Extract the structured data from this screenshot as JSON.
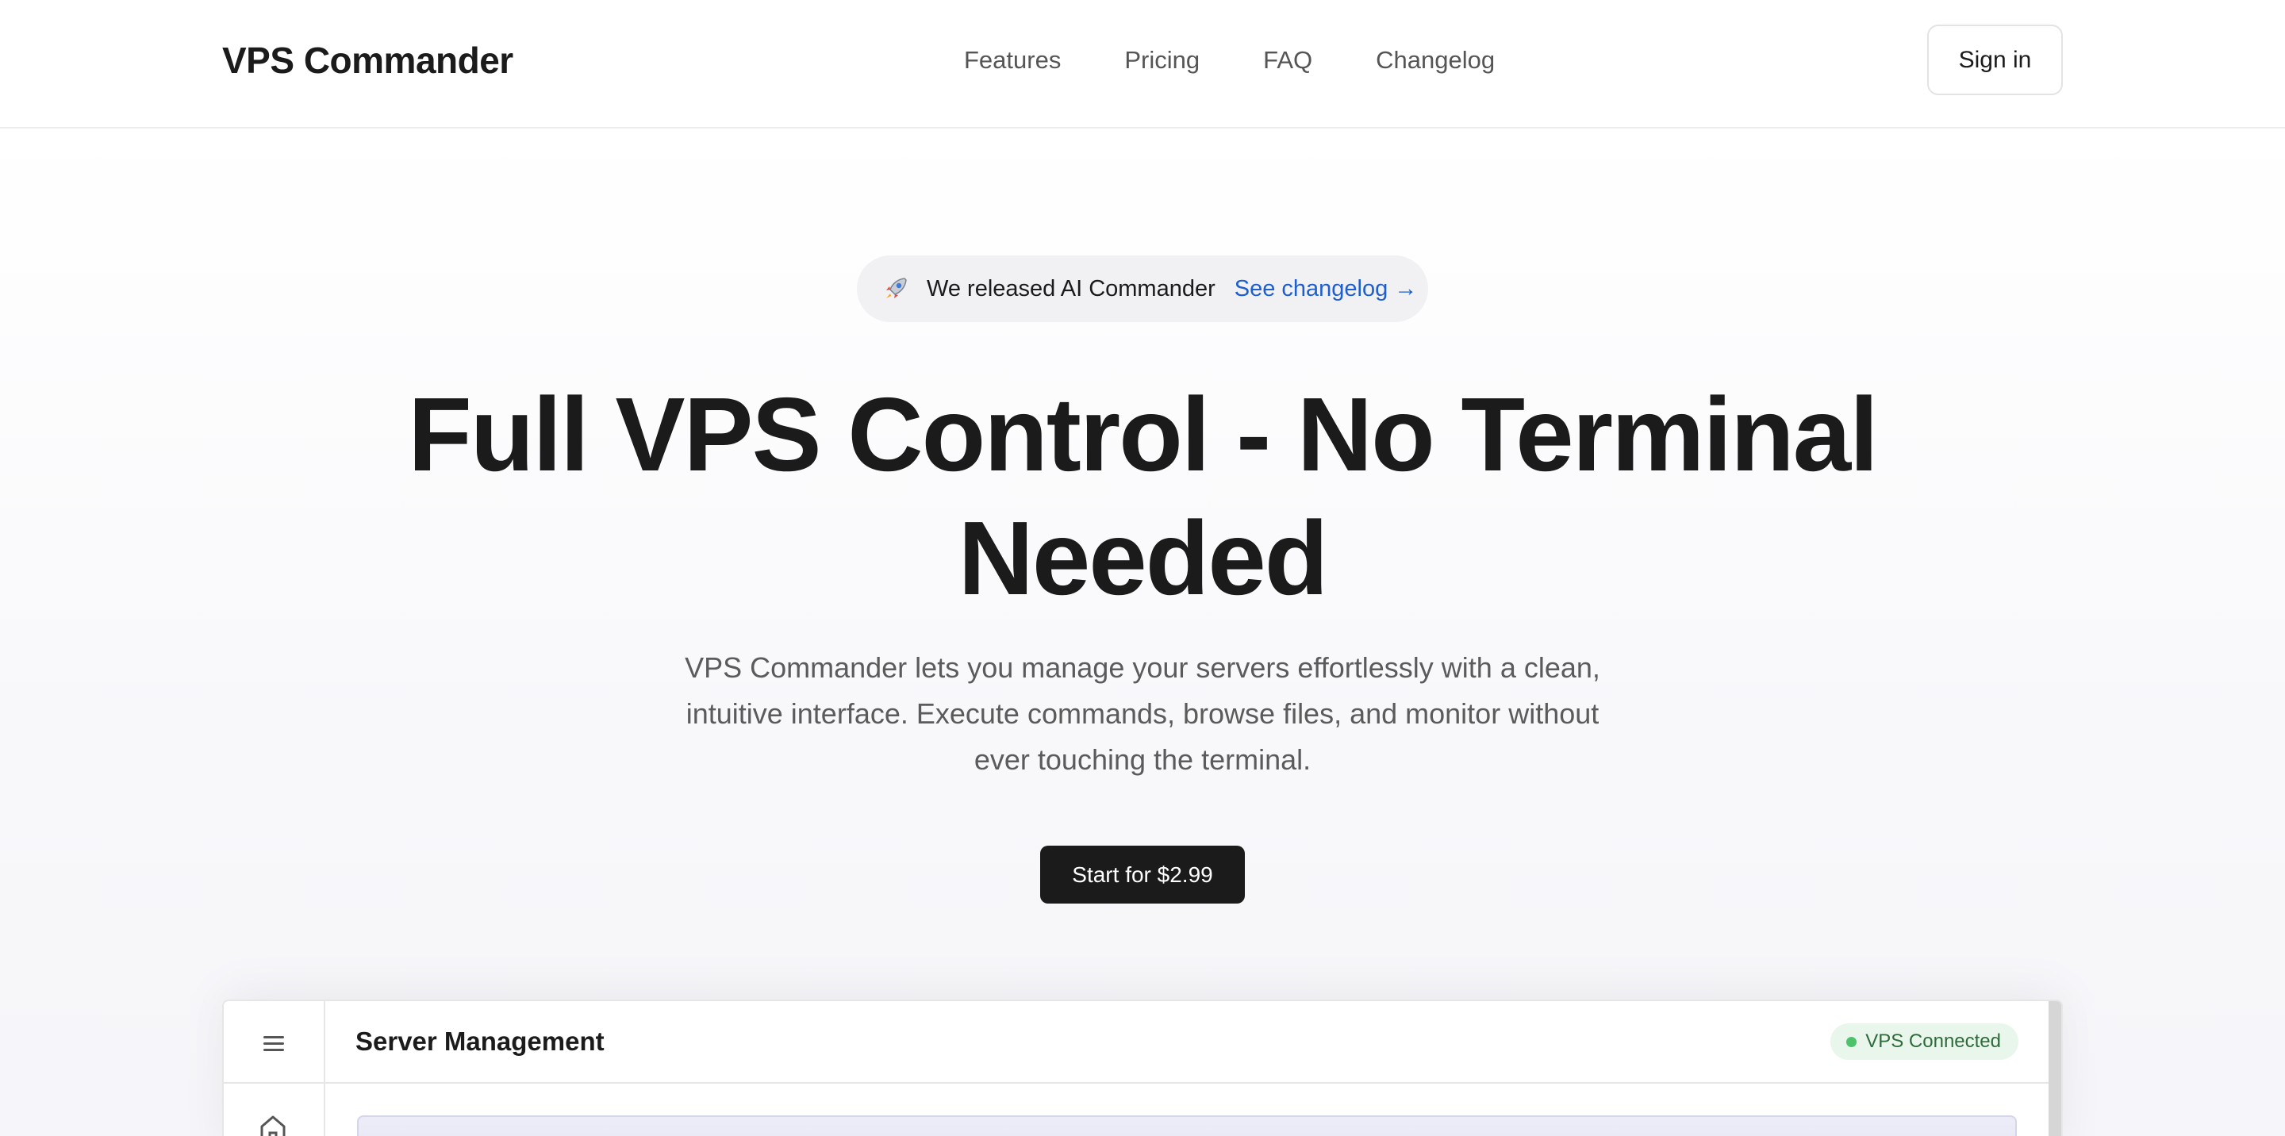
{
  "header": {
    "brand": "VPS Commander",
    "nav": [
      "Features",
      "Pricing",
      "FAQ",
      "Changelog"
    ],
    "signin_label": "Sign in"
  },
  "hero": {
    "announcement": {
      "icon": "rocket-icon",
      "message": "We released AI Commander",
      "link_label": "See changelog →"
    },
    "headline_line1": "Full VPS Control - No Terminal",
    "headline_line2": "Needed",
    "subtitle": "VPS Commander lets you manage your servers effortlessly with a clean, intuitive interface. Execute commands, browse files, and monitor without ever touching the terminal.",
    "cta_label": "Start for $2.99"
  },
  "preview": {
    "title": "Server Management",
    "status_badge": "VPS Connected",
    "sidebar_icons": [
      "menu-icon",
      "home-icon"
    ]
  },
  "colors": {
    "link": "#1d5fd1",
    "cta_bg": "#1b1b1b",
    "status_green": "#4cc36b"
  }
}
